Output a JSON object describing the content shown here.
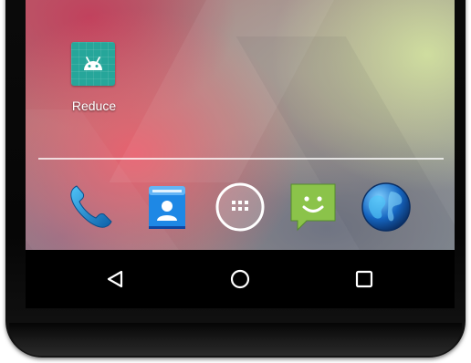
{
  "home_screen": {
    "shortcut": {
      "label": "Reduce",
      "icon": "android-icon",
      "color": "#26a69a"
    },
    "dock": [
      {
        "name": "phone",
        "icon": "phone-icon"
      },
      {
        "name": "contacts",
        "icon": "contacts-icon"
      },
      {
        "name": "app-drawer",
        "icon": "app-drawer-icon"
      },
      {
        "name": "messaging",
        "icon": "messaging-icon"
      },
      {
        "name": "browser",
        "icon": "globe-icon"
      }
    ]
  },
  "navigation_bar": {
    "buttons": [
      {
        "name": "back",
        "icon": "back-triangle-icon"
      },
      {
        "name": "home",
        "icon": "home-circle-icon"
      },
      {
        "name": "recents",
        "icon": "recents-square-icon"
      }
    ]
  }
}
